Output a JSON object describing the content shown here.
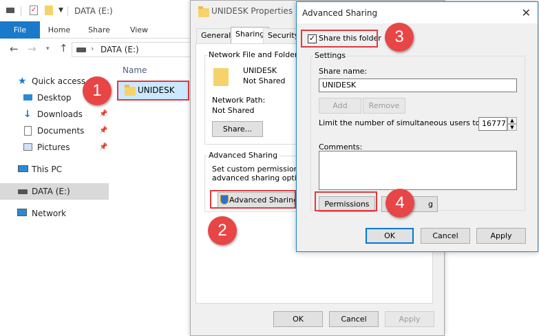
{
  "explorer": {
    "title": "DATA (E:)",
    "tabs": [
      "File",
      "Home",
      "Share",
      "View"
    ],
    "address": "DATA (E:)",
    "nav": {
      "quick_access": "Quick access",
      "desktop": "Desktop",
      "downloads": "Downloads",
      "documents": "Documents",
      "pictures": "Pictures",
      "this_pc": "This PC",
      "data_drive": "DATA (E:)",
      "network": "Network"
    },
    "column_name": "Name",
    "folder": "UNIDESK"
  },
  "properties": {
    "title": "UNIDESK Properties",
    "tabs": [
      "General",
      "Sharing",
      "Security"
    ],
    "network_group": "Network File and Folder Sh",
    "folder_name": "UNIDESK",
    "folder_status": "Not Shared",
    "network_path_label": "Network Path:",
    "network_path_value": "Not Shared",
    "share_button": "Share...",
    "adv_group": "Advanced Sharing",
    "adv_desc_1": "Set custom permissions, c",
    "adv_desc_2": "advanced sharing options",
    "adv_button": "Advanced Sharing",
    "ok": "OK",
    "cancel": "Cancel",
    "apply": "Apply"
  },
  "advanced": {
    "title": "Advanced Sharing",
    "share_checkbox": "Share this folder",
    "settings_group": "Settings",
    "share_name_label": "Share name:",
    "share_name_value": "UNIDESK",
    "add": "Add",
    "remove": "Remove",
    "limit_label": "Limit the number of simultaneous users to:",
    "limit_value": "16777",
    "comments_label": "Comments:",
    "permissions": "Permissions",
    "caching_partial": "g",
    "ok": "OK",
    "cancel": "Cancel",
    "apply": "Apply"
  },
  "callouts": [
    "1",
    "2",
    "3",
    "4"
  ],
  "colors": {
    "accent": "#1979ca",
    "highlight": "#e0393e",
    "callout": "#e84646"
  }
}
